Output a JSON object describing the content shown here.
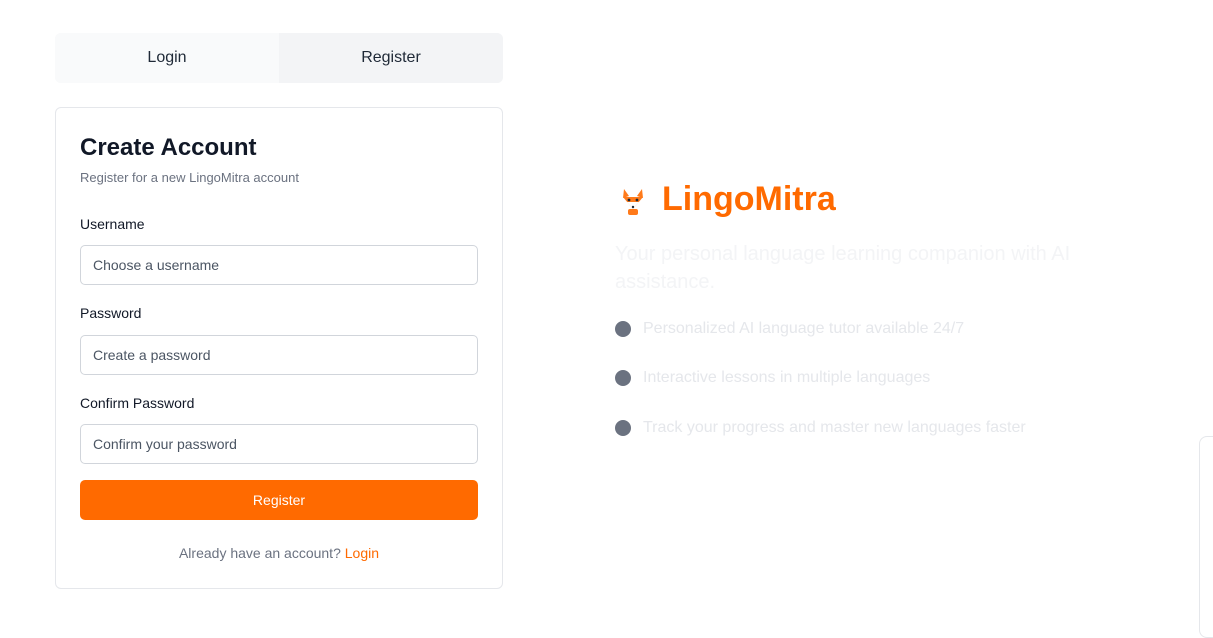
{
  "tabs": [
    {
      "label": "Login"
    },
    {
      "label": "Register"
    }
  ],
  "form": {
    "title": "Create Account",
    "subtitle": "Register for a new LingoMitra account",
    "username": {
      "label": "Username",
      "placeholder": "Choose a username",
      "value": ""
    },
    "password": {
      "label": "Password",
      "placeholder": "Create a password",
      "value": ""
    },
    "confirm": {
      "label": "Confirm Password",
      "placeholder": "Confirm your password",
      "value": ""
    },
    "submit_label": "Register",
    "footer_text": "Already have an account?",
    "footer_link": "Login"
  },
  "brand": {
    "logo_icon": "fox-icon",
    "name": "LingoMitra",
    "tagline": "Your personal language learning companion with AI assistance.",
    "features": [
      "Personalized AI language tutor available 24/7",
      "Interactive lessons in multiple languages",
      "Track your progress and master new languages faster"
    ]
  },
  "colors": {
    "accent": "#ff6a00",
    "bullet": "#6b7280"
  }
}
